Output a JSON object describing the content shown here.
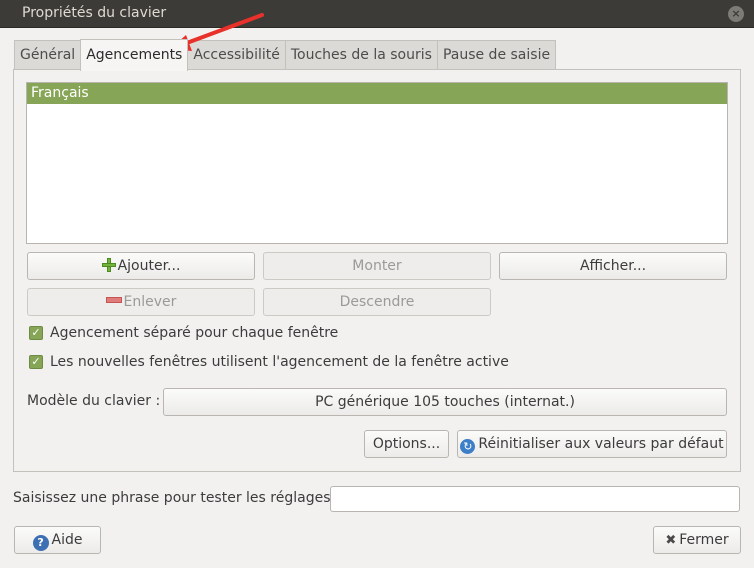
{
  "window": {
    "title": "Propriétés du clavier",
    "close_symbol": "×"
  },
  "tabs": [
    {
      "label": "Général",
      "active": false
    },
    {
      "label": "Agencements",
      "active": true
    },
    {
      "label": "Accessibilité",
      "active": false
    },
    {
      "label": "Touches de la souris",
      "active": false
    },
    {
      "label": "Pause de saisie",
      "active": false
    }
  ],
  "layouts": {
    "items": [
      {
        "label": "Français",
        "selected": true
      }
    ]
  },
  "buttons": {
    "add": "Ajouter...",
    "move_up": "Monter",
    "show": "Afficher...",
    "remove": "Enlever",
    "move_down": "Descendre",
    "options": "Options...",
    "reset": "Réinitialiser aux valeurs par défaut",
    "help": "Aide",
    "close": "Fermer"
  },
  "checkboxes": [
    {
      "label": "Agencement séparé pour chaque fenêtre",
      "checked": true
    },
    {
      "label": "Les nouvelles fenêtres utilisent l'agencement de la fenêtre active",
      "checked": true
    }
  ],
  "keyboard_model": {
    "label": "Modèle du clavier :",
    "value": "PC générique 105 touches (internat.)"
  },
  "test_field": {
    "label": "Saisissez une phrase pour tester les réglages :",
    "value": ""
  },
  "colors": {
    "accent": "#87a556",
    "titlebar": "#3c3b37",
    "annotation_arrow": "#e8312a"
  },
  "icons": {
    "add": "plus-icon",
    "remove": "minus-icon",
    "reset": "refresh-icon",
    "help": "help-icon",
    "close": "x-icon",
    "check": "✓"
  }
}
